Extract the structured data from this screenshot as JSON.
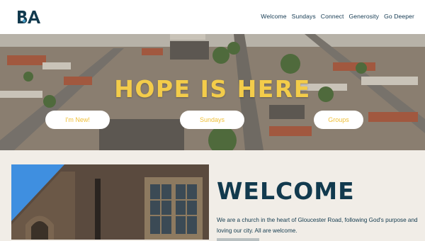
{
  "header": {
    "logo_alt": "BA",
    "nav": [
      "Welcome",
      "Sundays",
      "Connect",
      "Generosity",
      "Go Deeper"
    ]
  },
  "hero": {
    "title": "HOPE IS HERE",
    "buttons": [
      "I'm New!",
      "Sundays",
      "Groups"
    ]
  },
  "welcome": {
    "heading": "WELCOME",
    "text": "We are a church in the heart of Gloucester Road, following God's purpose and loving our city. All are welcome."
  },
  "colors": {
    "accent_yellow": "#f3cc4a",
    "navy": "#123a4e",
    "background": "#f1ede7"
  }
}
